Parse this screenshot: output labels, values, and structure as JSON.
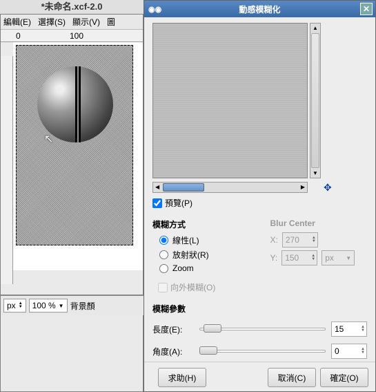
{
  "main": {
    "title": "*未命名.xcf-2.0",
    "menus": {
      "edit": "編輯(E)",
      "select": "選擇(S)",
      "view": "顯示(V)",
      "image": "圖"
    },
    "ruler": {
      "t0": "0",
      "t100": "100"
    },
    "bottom": {
      "unit": "px",
      "zoom": "100 %",
      "status": "背景顏"
    }
  },
  "dialog": {
    "title": "動感模糊化",
    "preview_label": "預覽(P)",
    "preview_checked": true,
    "method": {
      "title": "模糊方式",
      "linear": "線性(L)",
      "radial": "放射狀(R)",
      "zoom": "Zoom",
      "selected": "linear"
    },
    "center": {
      "title": "Blur Center",
      "x_label": "X:",
      "y_label": "Y:",
      "x": "270",
      "y": "150",
      "unit": "px"
    },
    "outward": {
      "label": "向外模糊(O)",
      "checked": false
    },
    "params": {
      "title": "模糊參數",
      "length_label": "長度(E):",
      "length": "15",
      "angle_label": "角度(A):",
      "angle": "0"
    },
    "buttons": {
      "help": "求助(H)",
      "cancel": "取消(C)",
      "ok": "確定(O)"
    }
  }
}
